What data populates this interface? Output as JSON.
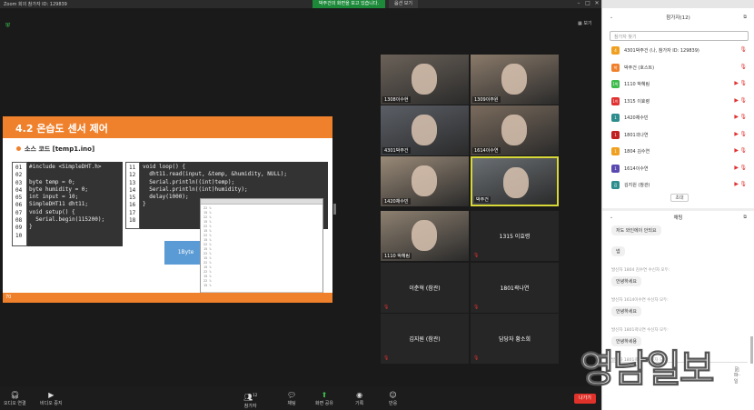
{
  "window": {
    "title": "Zoom 회의 참가자 ID: 129839",
    "banner": "박주건의 화면을 보고 있습니다.",
    "view_options": "옵션 보기",
    "gallery_label": "보기"
  },
  "slide": {
    "heading": "4.2 온습도 센서 제어",
    "subtitle": "소스 코드 [temp1.ino]",
    "code1_lines": [
      "01",
      "02",
      "03",
      "04",
      "05",
      "06",
      "07",
      "08",
      "09",
      "10"
    ],
    "code1": [
      "#include <SimpleDHT.h>",
      "",
      "byte temp = 0;",
      "byte humidity = 0;",
      "int input = 10;",
      "SimpleDHT11 dht11;",
      "void setup() {",
      "  Serial.begin(115200);",
      "}",
      ""
    ],
    "code2_lines": [
      "11",
      "12",
      "13",
      "14",
      "15",
      "16",
      "17",
      "18"
    ],
    "code2": [
      "void loop() {",
      "  dht11.read(input, &temp, &humidity, NULL);",
      "  Serial.println((int)temp);",
      "  Serial.println((int)humidity);",
      "  delay(1000);",
      "}",
      "",
      ""
    ],
    "box_label": "1Byte",
    "page_number": "70",
    "serial_lines": [
      "22 %",
      "15 %",
      "22 %",
      "15 %",
      "22 %",
      "15 %",
      "22 %",
      "15 %",
      "22 %",
      "15 %",
      "22 %",
      "15 %",
      "22 %",
      "15 %",
      "22 %",
      "15 %",
      "22 %",
      "15 %"
    ]
  },
  "tiles": [
    {
      "name": "1308이수현",
      "video": true
    },
    {
      "name": "1309이주원",
      "video": true
    },
    {
      "name": "4301박주건",
      "video": true
    },
    {
      "name": "1614이수연",
      "video": true
    },
    {
      "name": "1420채수빈",
      "video": true
    },
    {
      "name": "박주건",
      "video": true
    },
    {
      "name": "1110 박혜림",
      "video": true
    },
    {
      "name": "1315 이효령",
      "video": false
    },
    {
      "name": "이춘혁 (참관)",
      "video": false
    },
    {
      "name": "1801곽나연",
      "video": false
    },
    {
      "name": "김지원 (참관)",
      "video": false
    },
    {
      "name": "담당자 황소희",
      "video": false
    }
  ],
  "toolbar": {
    "audio": "오디오 연결",
    "video": "비디오 중지",
    "participants": "참가자",
    "participants_count": "12",
    "chat": "채팅",
    "share": "화면 공유",
    "record": "기록",
    "reactions": "반응",
    "leave": "나가기"
  },
  "participants_panel": {
    "title": "참가자(12)",
    "search_placeholder": "참가자 찾기",
    "rows": [
      {
        "badge": "4",
        "color": "#f0a020",
        "name": "4301박주건 (나, 참가자 ID: 129839)"
      },
      {
        "badge": "박",
        "color": "#f0812c",
        "name": "박주건 (호스트)"
      },
      {
        "badge": "1박",
        "color": "#3dbb4b",
        "name": "1110 박혜림"
      },
      {
        "badge": "1이",
        "color": "#e03030",
        "name": "1315 이효령"
      },
      {
        "badge": "1",
        "color": "#2d8c8c",
        "name": "1420채수빈"
      },
      {
        "badge": "1",
        "color": "#c02020",
        "name": "1801곽나연"
      },
      {
        "badge": "1",
        "color": "#f0a020",
        "name": "1804 김수연"
      },
      {
        "badge": "1",
        "color": "#5a4ab0",
        "name": "1614이수연"
      },
      {
        "badge": "김",
        "color": "#2d8c8c",
        "name": "김지원 (참관)"
      }
    ],
    "more": "초대"
  },
  "chat_panel": {
    "title": "채팅",
    "messages": [
      {
        "from": "",
        "text": "저도 와인에이 안되요"
      },
      {
        "from": "",
        "text": "넵"
      },
      {
        "from": "발신자 1804 김수연 수신자 모두:",
        "text": "안녕하세요"
      },
      {
        "from": "발신자 1614이수연 수신자 모두:",
        "text": "안녕하세요"
      },
      {
        "from": "발신자 1801곽나연 수신자 모두:",
        "text": "안녕하세용"
      },
      {
        "from": "발신자 1801곽나연 수신자 모두:",
        "text": ""
      }
    ],
    "file_label": "파일",
    "more_label": "..."
  },
  "watermark": "영남일보"
}
